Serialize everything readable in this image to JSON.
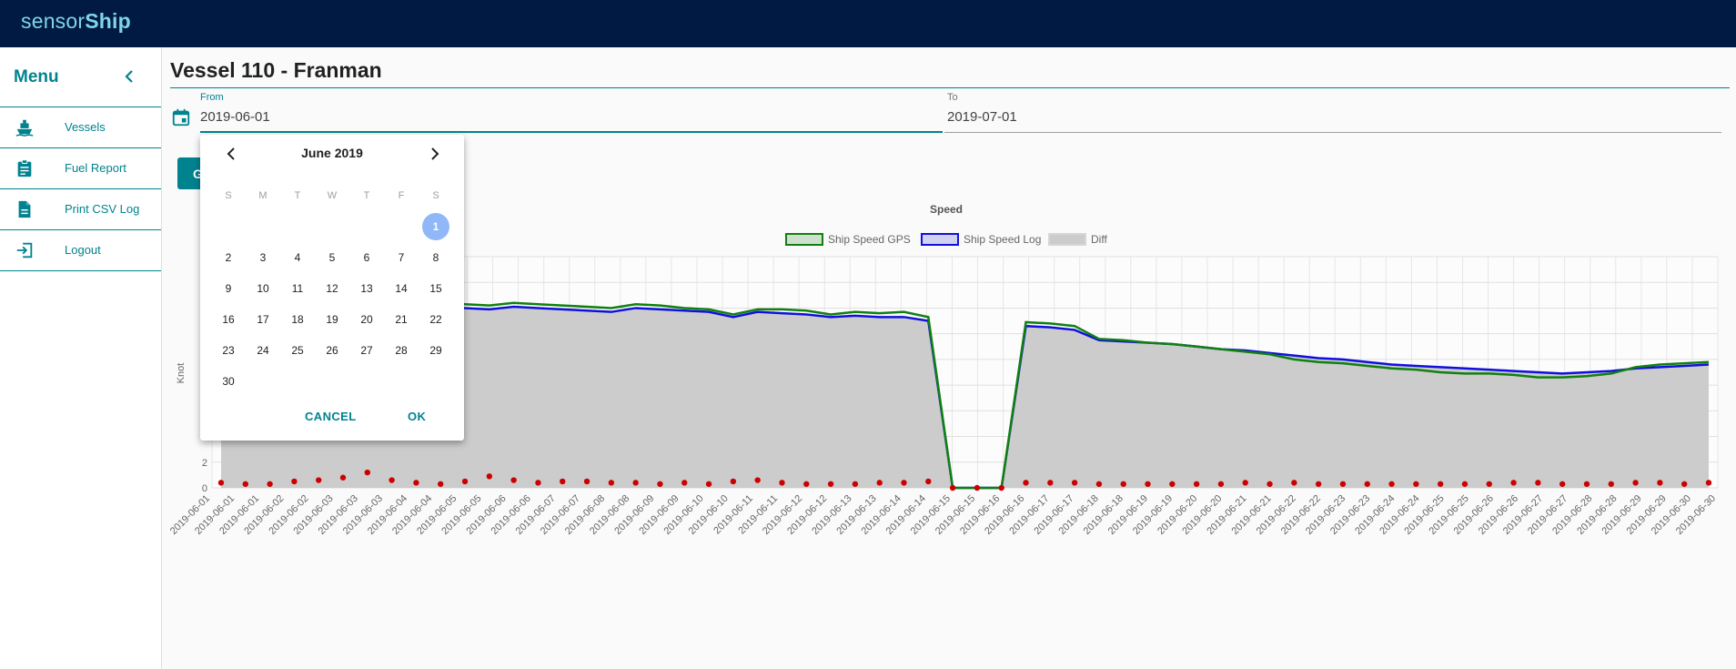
{
  "app": {
    "logo_light": "sensor",
    "logo_bold": "Ship"
  },
  "sidebar": {
    "title": "Menu",
    "items": [
      {
        "label": "Vessels",
        "icon": "ship-icon"
      },
      {
        "label": "Fuel Report",
        "icon": "clipboard-icon"
      },
      {
        "label": "Print CSV Log",
        "icon": "document-icon"
      },
      {
        "label": "Logout",
        "icon": "logout-icon"
      }
    ]
  },
  "page": {
    "title": "Vessel 110 - Franman"
  },
  "filters": {
    "from_label": "From",
    "from_value": "2019-06-01",
    "to_label": "To",
    "to_value": "2019-07-01",
    "go_label": "G"
  },
  "datepicker": {
    "month": "June 2019",
    "weekdays": [
      "S",
      "M",
      "T",
      "W",
      "T",
      "F",
      "S"
    ],
    "weeks": [
      [
        "",
        "",
        "",
        "",
        "",
        "",
        "1"
      ],
      [
        "2",
        "3",
        "4",
        "5",
        "6",
        "7",
        "8"
      ],
      [
        "9",
        "10",
        "11",
        "12",
        "13",
        "14",
        "15"
      ],
      [
        "16",
        "17",
        "18",
        "19",
        "20",
        "21",
        "22"
      ],
      [
        "23",
        "24",
        "25",
        "26",
        "27",
        "28",
        "29"
      ],
      [
        "30",
        "",
        "",
        "",
        "",
        "",
        ""
      ]
    ],
    "selected": "1",
    "cancel_label": "CANCEL",
    "ok_label": "OK"
  },
  "colors": {
    "accent": "#00838f",
    "header": "#001a43",
    "gps": "#118011",
    "log": "#1010dd",
    "diff_area": "#cccccc",
    "diff_points": "#cc0000",
    "selected_day": "#90b8f8"
  },
  "chart_data": {
    "type": "line",
    "title": "Speed",
    "ylabel": "Knot",
    "xlabel": "",
    "ylim": [
      0,
      18
    ],
    "y_ticks_visible": [
      "2",
      "0"
    ],
    "grid": true,
    "legend_position": "top-center",
    "x_tick_labels": [
      "2019-06-01",
      "2019-06-01",
      "2019-06-01",
      "2019-06-02",
      "2019-06-02",
      "2019-06-03",
      "2019-06-03",
      "2019-06-03",
      "2019-06-04",
      "2019-06-04",
      "2019-06-05",
      "2019-06-05",
      "2019-06-06",
      "2019-06-06",
      "2019-06-07",
      "2019-06-07",
      "2019-06-08",
      "2019-06-08",
      "2019-06-09",
      "2019-06-09",
      "2019-06-10",
      "2019-06-10",
      "2019-06-11",
      "2019-06-11",
      "2019-06-12",
      "2019-06-12",
      "2019-06-13",
      "2019-06-13",
      "2019-06-14",
      "2019-06-14",
      "2019-06-15",
      "2019-06-15",
      "2019-06-16",
      "2019-06-16",
      "2019-06-17",
      "2019-06-17",
      "2019-06-18",
      "2019-06-18",
      "2019-06-19",
      "2019-06-19",
      "2019-06-20",
      "2019-06-20",
      "2019-06-21",
      "2019-06-21",
      "2019-06-22",
      "2019-06-22",
      "2019-06-23",
      "2019-06-23",
      "2019-06-24",
      "2019-06-24",
      "2019-06-25",
      "2019-06-25",
      "2019-06-26",
      "2019-06-26",
      "2019-06-27",
      "2019-06-27",
      "2019-06-28",
      "2019-06-28",
      "2019-06-29",
      "2019-06-29",
      "2019-06-30",
      "2019-06-30"
    ],
    "series": [
      {
        "name": "Ship Speed GPS",
        "values": [
          14.8,
          14.9,
          15.0,
          14.8,
          14.9,
          14.8,
          15.0,
          14.9,
          14.7,
          14.5,
          14.3,
          14.2,
          14.4,
          14.3,
          14.2,
          14.1,
          14.0,
          14.3,
          14.2,
          14.0,
          13.9,
          13.5,
          13.9,
          13.9,
          13.8,
          13.5,
          13.7,
          13.6,
          13.7,
          13.3,
          0.0,
          0.0,
          0.0,
          12.9,
          12.8,
          12.6,
          11.6,
          11.5,
          11.3,
          11.2,
          11.0,
          10.8,
          10.6,
          10.4,
          10.0,
          9.8,
          9.7,
          9.5,
          9.3,
          9.2,
          9.0,
          8.9,
          8.9,
          8.8,
          8.6,
          8.6,
          8.7,
          8.9,
          9.4,
          9.6,
          9.7,
          9.8
        ]
      },
      {
        "name": "Ship Speed Log",
        "values": [
          14.3,
          14.4,
          14.4,
          14.3,
          14.3,
          14.3,
          14.4,
          14.4,
          14.3,
          14.2,
          14.0,
          13.9,
          14.1,
          14.0,
          13.9,
          13.8,
          13.7,
          14.0,
          13.9,
          13.8,
          13.7,
          13.3,
          13.7,
          13.6,
          13.5,
          13.3,
          13.4,
          13.3,
          13.3,
          13.0,
          0.0,
          0.0,
          0.0,
          12.6,
          12.5,
          12.3,
          11.5,
          11.4,
          11.3,
          11.2,
          11.0,
          10.8,
          10.7,
          10.5,
          10.3,
          10.1,
          10.0,
          9.8,
          9.6,
          9.5,
          9.4,
          9.3,
          9.2,
          9.1,
          9.0,
          8.9,
          9.0,
          9.1,
          9.3,
          9.4,
          9.5,
          9.6
        ]
      },
      {
        "name": "Diff",
        "values": [
          0.4,
          0.3,
          0.3,
          0.5,
          0.6,
          0.8,
          1.2,
          0.6,
          0.4,
          0.3,
          0.5,
          0.9,
          0.6,
          0.4,
          0.5,
          0.5,
          0.4,
          0.4,
          0.3,
          0.4,
          0.3,
          0.5,
          0.6,
          0.4,
          0.3,
          0.3,
          0.3,
          0.4,
          0.4,
          0.5,
          0.0,
          0.0,
          0.0,
          0.4,
          0.4,
          0.4,
          0.3,
          0.3,
          0.3,
          0.3,
          0.3,
          0.3,
          0.4,
          0.3,
          0.4,
          0.3,
          0.3,
          0.3,
          0.3,
          0.3,
          0.3,
          0.3,
          0.3,
          0.4,
          0.4,
          0.3,
          0.3,
          0.3,
          0.4,
          0.4,
          0.3,
          0.4
        ]
      }
    ]
  }
}
